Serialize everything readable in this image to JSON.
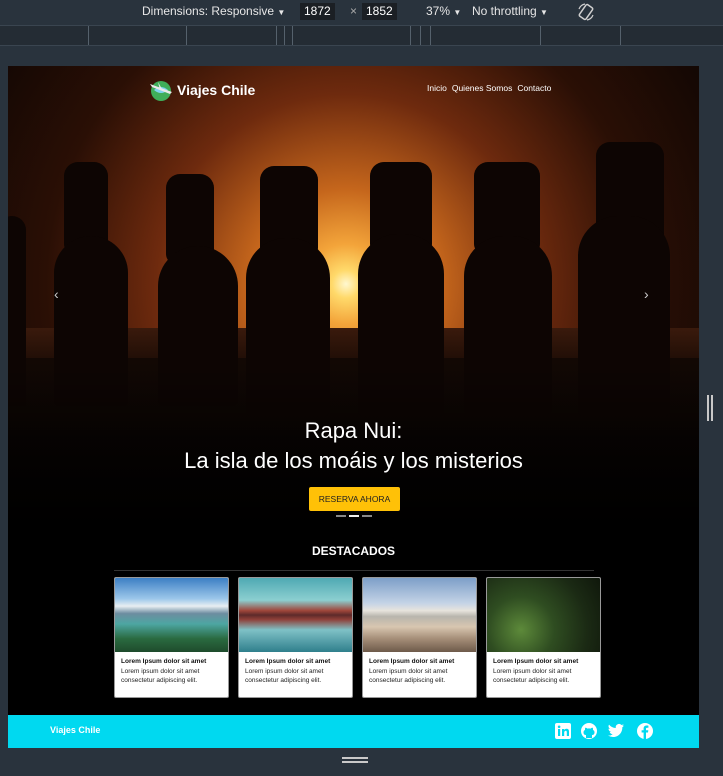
{
  "devtools": {
    "dimensions_label": "Dimensions: Responsive",
    "width_value": "1872",
    "times": "×",
    "height_value": "1852",
    "zoom": "37%",
    "throttling": "No throttling",
    "caret": "▼"
  },
  "site": {
    "brand": "Viajes Chile",
    "nav": [
      "Inicio",
      "Quienes Somos",
      "Contacto"
    ],
    "hero": {
      "prev": "‹",
      "next": "›",
      "title_line1": "Rapa Nui:",
      "title_line2": "La isla de los moáis y los misterios",
      "cta": "RESERVA AHORA",
      "slides": 3,
      "active_slide": 2
    },
    "featured": {
      "title": "DESTACADOS",
      "cards": [
        {
          "title": "Lorem Ipsum dolor sit amet",
          "text": "Lorem ipsum dolor sit amet consectetur adipiscing elit."
        },
        {
          "title": "Lorem Ipsum dolor sit amet",
          "text": "Lorem ipsum dolor sit amet consectetur adipiscing elit."
        },
        {
          "title": "Lorem Ipsum dolor sit amet",
          "text": "Lorem ipsum dolor sit amet consectetur adipiscing elit."
        },
        {
          "title": "Lorem Ipsum dolor sit amet",
          "text": "Lorem ipsum dolor sit amet consectetur adipiscing elit."
        }
      ]
    },
    "footer": {
      "brand": "Viajes Chile",
      "social_icons": [
        "linkedin-icon",
        "github-icon",
        "twitter-icon",
        "facebook-icon"
      ]
    }
  },
  "colors": {
    "cta": "#ffc107",
    "footer": "#00d9f0",
    "devtools_bg": "#29333d"
  }
}
